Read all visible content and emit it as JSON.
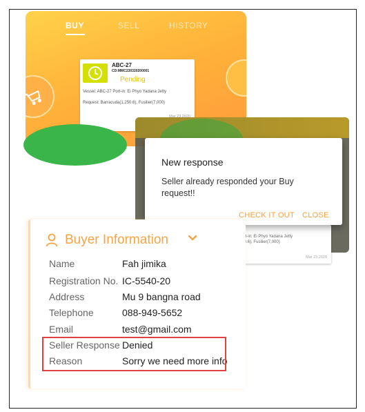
{
  "tabs": {
    "buy": "BUY",
    "sell": "SELL",
    "history": "HISTORY"
  },
  "order": {
    "id": "ABC-27",
    "code": "CD:MMC230320200001",
    "status": "Pending",
    "vessel_line": "Vessel: ABC-27  Port-in: Ei Phyo Yadana Jetty",
    "request_line": "Request: Barracuda(1,250.6), Fusilier(7,000)",
    "date": "Mar 23,2020"
  },
  "bg_card": {
    "line1": "la Tinn  Port-in: Ei Phyo Yadana Jetty",
    "line2": "cuda(1,250.6), Fusilier(7,000)",
    "date": "Mar 23,2020"
  },
  "dialog": {
    "title": "New response",
    "message": "Seller already responded your Buy request!!",
    "check_label": "CHECK IT OUT",
    "close_label": "CLOSE"
  },
  "buyer": {
    "title": "Buyer Information",
    "rows": [
      {
        "label": "Name",
        "value": "Fah jimika"
      },
      {
        "label": "Registration No.",
        "value": "IC-5540-20"
      },
      {
        "label": "Address",
        "value": "Mu 9 bangna road"
      },
      {
        "label": "Telephone",
        "value": "088-949-5652"
      },
      {
        "label": "Email",
        "value": "test@gmail.com"
      },
      {
        "label": "Seller Response",
        "value": "Denied"
      },
      {
        "label": "Reason",
        "value": "Sorry we need more info"
      }
    ]
  },
  "colors": {
    "accent": "#f5a446",
    "highlight": "#e0403f",
    "pending": "#e3c400"
  }
}
